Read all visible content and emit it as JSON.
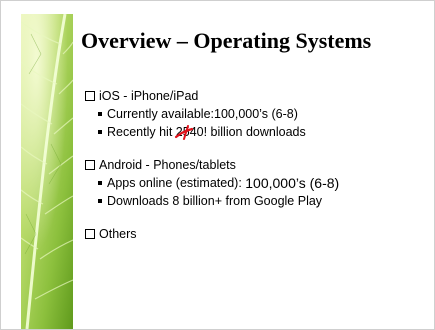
{
  "slide": {
    "title": "Overview – Operating Systems",
    "sections": [
      {
        "label": "iOS - iPhone/iPad",
        "items": [
          {
            "prefix": "Currently available: ",
            "text": "100,000’s (6-8)"
          },
          {
            "pre": "Recently hit ",
            "struck": "25",
            "post": "40! billion downloads"
          }
        ]
      },
      {
        "label": "Android - Phones/tablets",
        "items": [
          {
            "prefix": "Apps online (estimated): ",
            "text": "100,000’s (6-8)"
          },
          {
            "text": "Downloads 8 billion+ from Google Play"
          }
        ]
      },
      {
        "label": "Others",
        "items": []
      }
    ]
  },
  "colors": {
    "leaf_green_light": "#cfe88a",
    "leaf_green_dark": "#5f9a1c",
    "annotation_red": "#e0121b"
  },
  "icons": {
    "section_bullet": "checkbox-square-icon",
    "item_bullet": "filled-square-icon"
  }
}
